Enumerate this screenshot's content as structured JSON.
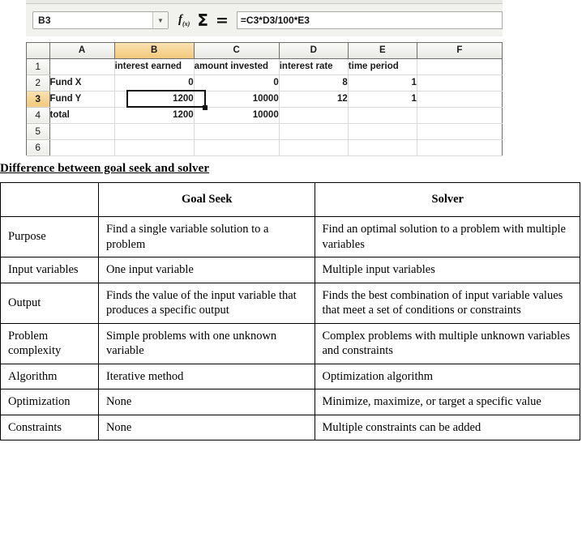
{
  "spreadsheet": {
    "name_box": {
      "value": "B3",
      "dropdown_icon": "chevron-down-icon"
    },
    "formula_toolbar_icons": [
      {
        "name": "function-wizard-icon",
        "glyph": "f(x)"
      },
      {
        "name": "sum-icon",
        "glyph": "Σ"
      },
      {
        "name": "formula-equals-icon",
        "glyph": "="
      }
    ],
    "formula_input": {
      "value": "=C3*D3/100*E3"
    },
    "active_cell": "B3",
    "active_column": "B",
    "active_row": "3",
    "column_headers": [
      "A",
      "B",
      "C",
      "D",
      "E",
      "F"
    ],
    "row_headers": [
      "1",
      "2",
      "3",
      "4",
      "5",
      "6"
    ],
    "rows": [
      {
        "head": "1",
        "cells": [
          "",
          "interest earned",
          "amount invested",
          "interest rate",
          "time period",
          ""
        ]
      },
      {
        "head": "2",
        "cells": [
          "Fund X",
          "0",
          "0",
          "8",
          "1",
          ""
        ]
      },
      {
        "head": "3",
        "cells": [
          "Fund Y",
          "1200",
          "10000",
          "12",
          "1",
          ""
        ]
      },
      {
        "head": "4",
        "cells": [
          "total",
          "1200",
          "10000",
          "",
          "",
          ""
        ]
      },
      {
        "head": "5",
        "cells": [
          "",
          "",
          "",
          "",
          "",
          ""
        ]
      },
      {
        "head": "6",
        "cells": [
          "",
          "",
          "",
          "",
          "",
          ""
        ]
      }
    ]
  },
  "document": {
    "heading": "Difference between goal seek and solver",
    "comparison_table": {
      "headers": [
        "",
        "Goal Seek",
        "Solver"
      ],
      "rows": [
        {
          "feature": "Purpose",
          "goal_seek": "Find a single variable solution to a problem",
          "solver": "Find an optimal solution to a problem with multiple variables"
        },
        {
          "feature": "Input variables",
          "goal_seek": "One input variable",
          "solver": "Multiple input variables"
        },
        {
          "feature": "Output",
          "goal_seek": "Finds the value of the input variable that produces a specific output",
          "solver": "Finds the best combination of input variable values that meet a set of conditions or constraints"
        },
        {
          "feature": "Problem complexity",
          "goal_seek": "Simple problems with one unknown variable",
          "solver": "Complex problems with multiple unknown variables and constraints"
        },
        {
          "feature": "Algorithm",
          "goal_seek": "Iterative method",
          "solver": "Optimization algorithm"
        },
        {
          "feature": "Optimization",
          "goal_seek": "None",
          "solver": "Minimize, maximize, or target a specific value"
        },
        {
          "feature": "Constraints",
          "goal_seek": "None",
          "solver": "Multiple constraints can be added"
        }
      ]
    }
  },
  "colors": {
    "active_header_amber": "#f2c97c",
    "grid_line": "#d9d9d5",
    "grid_border": "#6d6d6a",
    "toolbar_bg": "#f1f1ee"
  }
}
